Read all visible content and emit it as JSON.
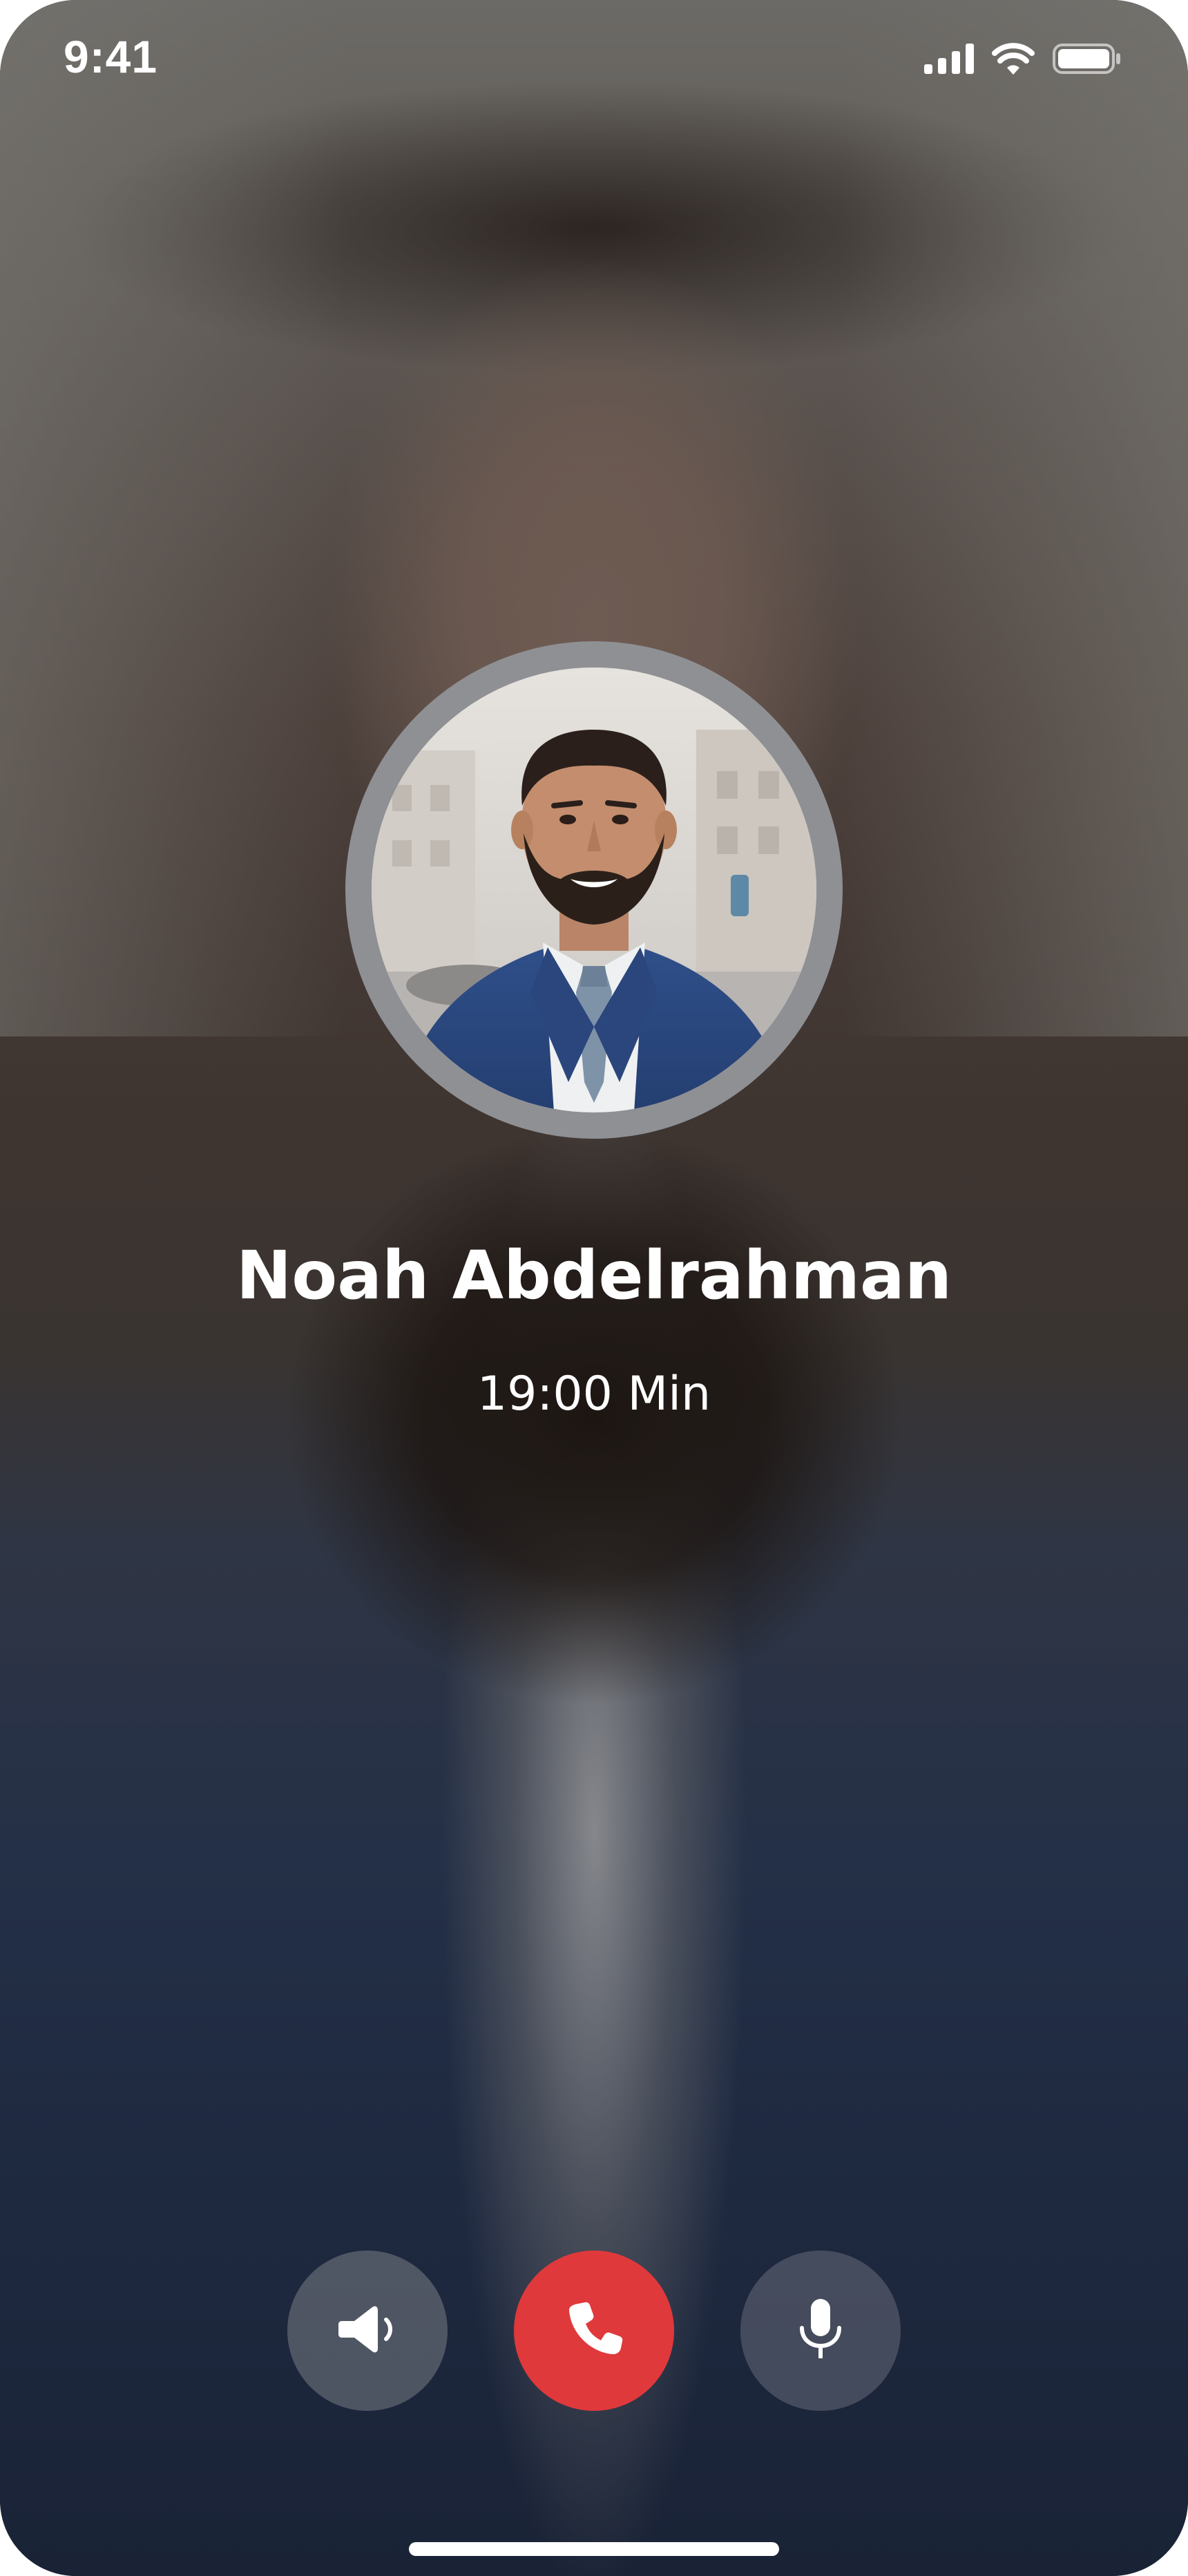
{
  "status_bar": {
    "time": "9:41",
    "icons": [
      "cellular-signal-icon",
      "wifi-icon",
      "battery-icon"
    ]
  },
  "caller": {
    "name": "Noah Abdelrahman",
    "duration": "19:00 Min",
    "avatar": "caller-avatar-photo"
  },
  "controls": [
    {
      "name": "speaker-button",
      "icon": "speaker-icon"
    },
    {
      "name": "end-call-button",
      "icon": "phone-icon",
      "color": "#e0393b"
    },
    {
      "name": "mute-button",
      "icon": "microphone-icon"
    }
  ],
  "colors": {
    "end_call": "#e0393b",
    "text": "#ffffff"
  }
}
